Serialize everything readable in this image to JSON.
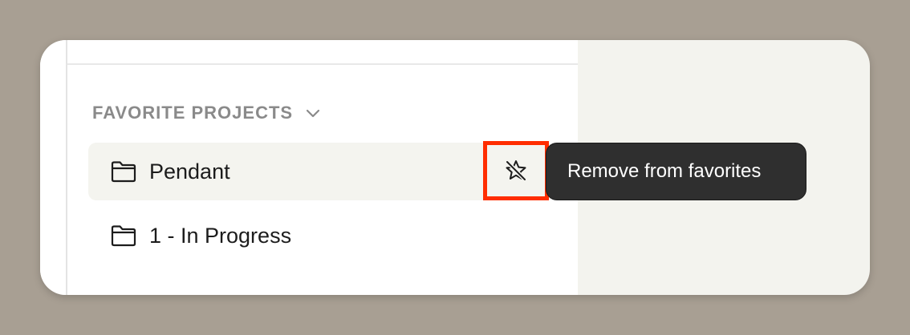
{
  "sidebar": {
    "favorite_projects": {
      "title": "FAVORITE PROJECTS",
      "toggle_icon": "chevron-down-icon",
      "items": [
        {
          "label": "Pendant",
          "icon": "folder-icon",
          "highlighted": true
        },
        {
          "label": "1 - In Progress",
          "icon": "folder-icon",
          "highlighted": false
        }
      ]
    },
    "remove_favorite_action": {
      "icon": "star-off-icon",
      "tooltip": "Remove from favorites",
      "highlight_color": "#ff2d00"
    }
  },
  "colors": {
    "backdrop": "#a89f93",
    "sidebar_bg": "#ffffff",
    "main_bg": "#f3f3ee",
    "tooltip_bg": "#2f2f2f",
    "section_title": "#8a8a8a"
  }
}
